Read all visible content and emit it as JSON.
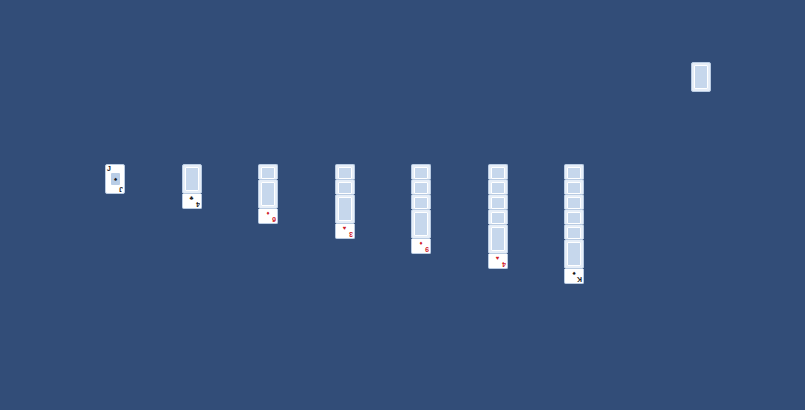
{
  "stock": {
    "face_down": true
  },
  "tableau": [
    {
      "face_down": 0,
      "face_up": {
        "rank": "J",
        "suit": "♠",
        "color": "#1a1a1a"
      }
    },
    {
      "face_down": 1,
      "face_up": {
        "rank": "4",
        "suit": "♣",
        "color": "#1a1a1a"
      }
    },
    {
      "face_down": 2,
      "face_up": {
        "rank": "6",
        "suit": "♦",
        "color": "#d0202a"
      }
    },
    {
      "face_down": 3,
      "face_up": {
        "rank": "3",
        "suit": "♥",
        "color": "#d0202a"
      }
    },
    {
      "face_down": 4,
      "face_up": {
        "rank": "9",
        "suit": "♦",
        "color": "#d0202a"
      }
    },
    {
      "face_down": 5,
      "face_up": {
        "rank": "4",
        "suit": "♥",
        "color": "#d0202a"
      }
    },
    {
      "face_down": 6,
      "face_up": {
        "rank": "K",
        "suit": "♠",
        "color": "#1a1a1a"
      }
    }
  ]
}
